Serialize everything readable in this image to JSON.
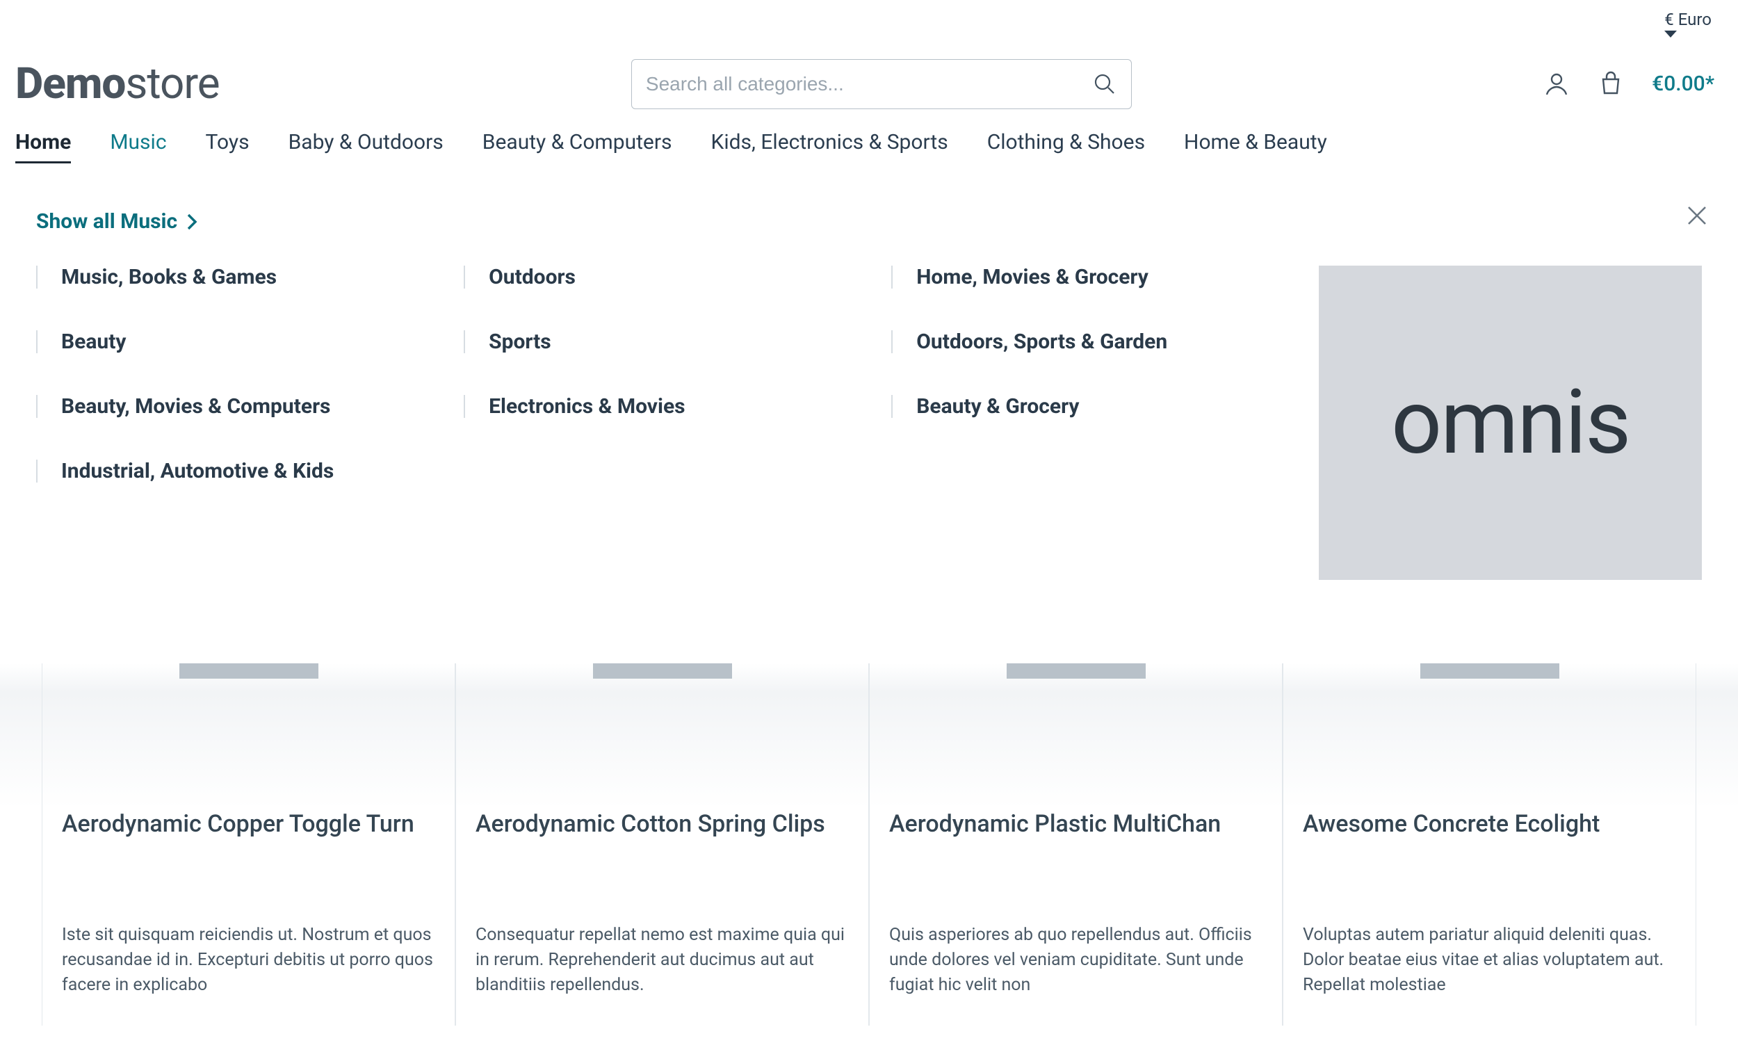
{
  "currency": {
    "label": "€ Euro"
  },
  "logo": {
    "bold": "Demo",
    "light": "store"
  },
  "search": {
    "placeholder": "Search all categories..."
  },
  "cart": {
    "amount": "€0.00*"
  },
  "nav": {
    "items": [
      {
        "label": "Home"
      },
      {
        "label": "Music"
      },
      {
        "label": "Toys"
      },
      {
        "label": "Baby & Outdoors"
      },
      {
        "label": "Beauty & Computers"
      },
      {
        "label": "Kids, Electronics & Sports"
      },
      {
        "label": "Clothing & Shoes"
      },
      {
        "label": "Home & Beauty"
      }
    ]
  },
  "mega": {
    "show_all": "Show all Music",
    "banner_text": "omnis",
    "cols": [
      [
        {
          "label": "Music, Books & Games"
        },
        {
          "label": "Beauty"
        },
        {
          "label": "Beauty, Movies & Computers"
        },
        {
          "label": "Industrial, Automotive & Kids"
        }
      ],
      [
        {
          "label": "Outdoors"
        },
        {
          "label": "Sports"
        },
        {
          "label": "Electronics & Movies"
        }
      ],
      [
        {
          "label": "Home, Movies & Grocery"
        },
        {
          "label": "Outdoors, Sports & Garden"
        },
        {
          "label": "Beauty & Grocery"
        }
      ]
    ]
  },
  "products": [
    {
      "title": "Aerodynamic Copper Toggle Turn",
      "desc": "Iste sit quisquam reiciendis ut. Nostrum et quos recusandae id in. Excepturi debitis ut porro quos facere in explicabo"
    },
    {
      "title": "Aerodynamic Cotton Spring Clips",
      "desc": "Consequatur repellat nemo est maxime quia qui in rerum. Reprehenderit aut ducimus aut aut blanditiis repellendus."
    },
    {
      "title": "Aerodynamic Plastic MultiChan",
      "desc": "Quis asperiores ab quo repellendus aut. Officiis unde dolores vel veniam cupiditate. Sunt unde fugiat hic velit non"
    },
    {
      "title": "Awesome Concrete Ecolight",
      "desc": "Voluptas autem pariatur aliquid deleniti quas. Dolor beatae eius vitae et alias voluptatem aut. Repellat molestiae"
    }
  ]
}
